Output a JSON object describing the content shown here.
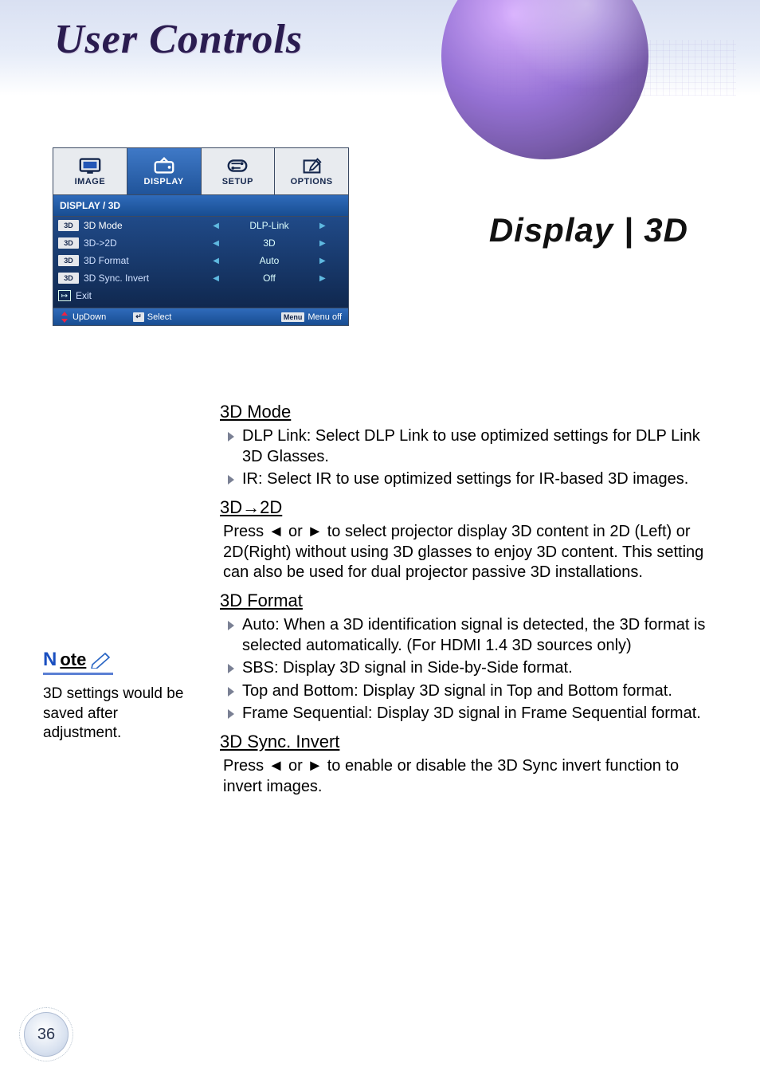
{
  "page": {
    "title": "User Controls",
    "section_title": "Display | 3D",
    "number": "36"
  },
  "osd": {
    "tabs": [
      {
        "label": "IMAGE"
      },
      {
        "label": "DISPLAY"
      },
      {
        "label": "SETUP"
      },
      {
        "label": "OPTIONS"
      }
    ],
    "active_tab_index": 1,
    "breadcrumb": "DISPLAY / 3D",
    "rows": [
      {
        "tag": "3D",
        "label": "3D Mode",
        "value": "DLP-Link"
      },
      {
        "tag": "3D",
        "label": "3D->2D",
        "value": "3D"
      },
      {
        "tag": "3D",
        "label": "3D Format",
        "value": "Auto"
      },
      {
        "tag": "3D",
        "label": "3D Sync. Invert",
        "value": "Off"
      }
    ],
    "exit_label": "Exit",
    "footer": {
      "updown": "UpDown",
      "select": "Select",
      "menu_key": "Menu",
      "menu_label": "Menu off"
    }
  },
  "note": {
    "heading_n": "N",
    "heading_ote": "ote",
    "body": "3D settings would be saved after adjustment."
  },
  "doc": {
    "s1": {
      "heading": "3D Mode",
      "items": [
        "DLP Link: Select DLP Link to use optimized settings for DLP Link 3D Glasses.",
        "IR: Select IR to use optimized settings for IR-based 3D images."
      ]
    },
    "s2": {
      "heading": "3D→2D",
      "para": "Press ◄ or ► to select projector display 3D content in 2D (Left) or 2D(Right) without using 3D glasses to enjoy 3D content. This setting can also be used for dual projector passive 3D installations."
    },
    "s3": {
      "heading": "3D Format",
      "items": [
        "Auto: When a 3D identification signal is detected, the 3D format is selected automatically. (For HDMI 1.4 3D sources only)",
        "SBS: Display 3D signal in Side-by-Side format.",
        "Top and Bottom: Display 3D signal in Top and Bottom format.",
        "Frame Sequential: Display 3D signal in Frame Sequential format."
      ]
    },
    "s4": {
      "heading": "3D Sync. Invert",
      "para": "Press ◄ or ► to enable or disable the 3D Sync invert function to invert images."
    }
  }
}
